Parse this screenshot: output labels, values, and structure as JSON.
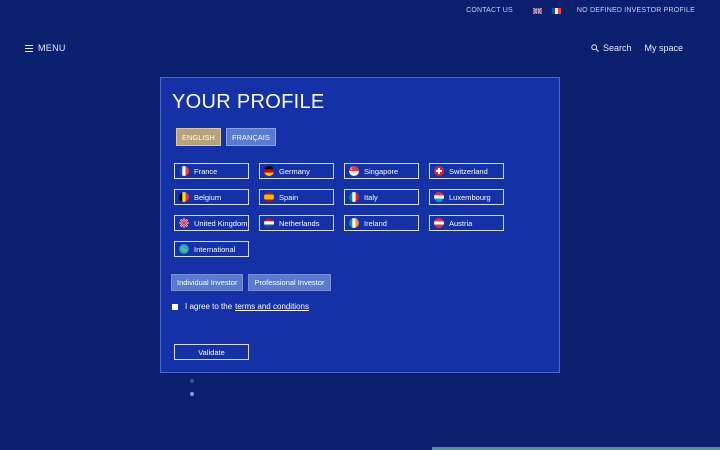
{
  "topbar": {
    "contact_label": "CONTACT US",
    "profile_status": "NO DEFINED INVESTOR PROFILE"
  },
  "nav": {
    "menu_label": "MENU",
    "search_label": "Search",
    "myspace_label": "My space"
  },
  "profile": {
    "title": "YOUR PROFILE",
    "languages": [
      {
        "label": "ENGLISH",
        "active": true
      },
      {
        "label": "FRANÇAIS",
        "active": false
      }
    ],
    "countries": [
      {
        "label": "France"
      },
      {
        "label": "Germany"
      },
      {
        "label": "Singapore"
      },
      {
        "label": "Switzerland"
      },
      {
        "label": "Belgium"
      },
      {
        "label": "Spain"
      },
      {
        "label": "Italy"
      },
      {
        "label": "Luxembourg"
      },
      {
        "label": "United Kingdom"
      },
      {
        "label": "Netherlands"
      },
      {
        "label": "Ireland"
      },
      {
        "label": "Austria"
      },
      {
        "label": "International"
      }
    ],
    "investor_types": [
      {
        "label": "Individual Investor"
      },
      {
        "label": "Professional Investor"
      }
    ],
    "agree_text": "I agree to the",
    "terms_link": "terms and conditions",
    "validate_label": "Validate"
  },
  "colors": {
    "background": "#0a1f6e",
    "panel": "#1431a8",
    "lang_active": "#b8a27a",
    "button": "#5a7ad0"
  }
}
